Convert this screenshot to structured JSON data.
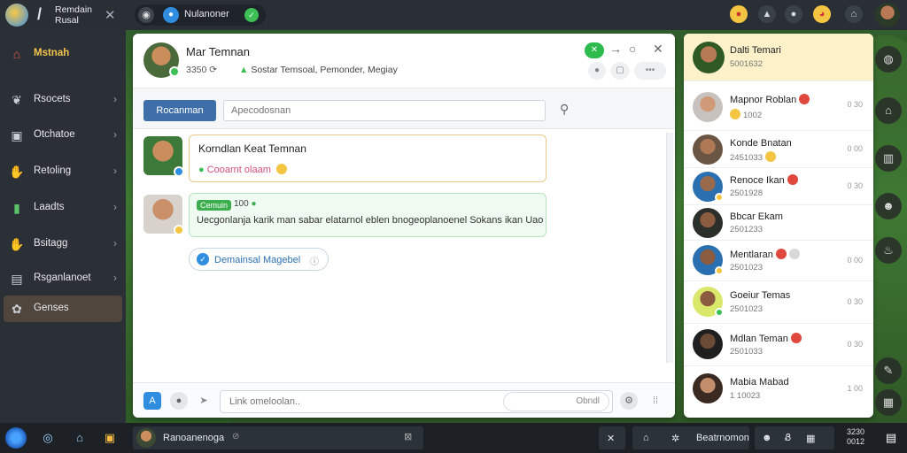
{
  "topbar": {
    "brand_line1": "Remdain",
    "brand_line2": "Rusal",
    "pill_label": "Nulanoner"
  },
  "sidebar": {
    "brand_label": "Mstnah",
    "items": [
      {
        "label": "Rsocets",
        "icon": "leaf-icon"
      },
      {
        "label": "Otchatoe",
        "icon": "bag-icon"
      },
      {
        "label": "Retoling",
        "icon": "hand-icon"
      },
      {
        "label": "Laadts",
        "icon": "chart-icon"
      },
      {
        "label": "Bsitagg",
        "icon": "hand-icon"
      },
      {
        "label": "Rsganlanoet",
        "icon": "book-icon"
      },
      {
        "label": "Genses",
        "icon": "globe-icon"
      }
    ]
  },
  "chat": {
    "title": "Mar Temnan",
    "sub_count": "3350",
    "meta": "Sostar  Temsoal,  Pemonder,  Megiay",
    "toolbar_button": "Rocanman",
    "toolbar_placeholder": "Apecodosnan",
    "messages": [
      {
        "title": "Korndlan Keat Temnan",
        "sub": "Cooarnt olaam"
      },
      {
        "badge": "Cemuin",
        "num": "100",
        "body": "Uecgonlanja karik man sabar elatarnol eblen bnogeoplanoenel Sokans ikan Uaorlng"
      }
    ],
    "verified_label": "Demainsal Magebel",
    "composer_placeholder": "Link omeloolan..",
    "composer_send": "Obndl"
  },
  "contacts": [
    {
      "name": "Dalti Temari",
      "sub": "5001632",
      "right": ""
    },
    {
      "name": "Mapnor Roblan",
      "sub": "1002",
      "right": "0 30"
    },
    {
      "name": "Konde Bnatan",
      "sub": "2451033",
      "right": "0 00"
    },
    {
      "name": "Renoce Ikan",
      "sub": "2501928",
      "right": "0 30"
    },
    {
      "name": "Bbcar Ekam",
      "sub": "2501233",
      "right": "0 00"
    },
    {
      "name": "Mentlaran",
      "sub": "2501023",
      "right": "0 00"
    },
    {
      "name": "Goeiur Temas",
      "sub": "2501023",
      "right": "0 30"
    },
    {
      "name": "Mdlan Teman",
      "sub": "2501033",
      "right": "0 30"
    },
    {
      "name": "Mabia Mabad",
      "sub": "1 10023",
      "right": "1 00"
    }
  ],
  "taskbar": {
    "task_label": "Ranoanenoga",
    "right_label": "Beatrnomon",
    "clock_time": "3230",
    "clock_date": "0012"
  }
}
